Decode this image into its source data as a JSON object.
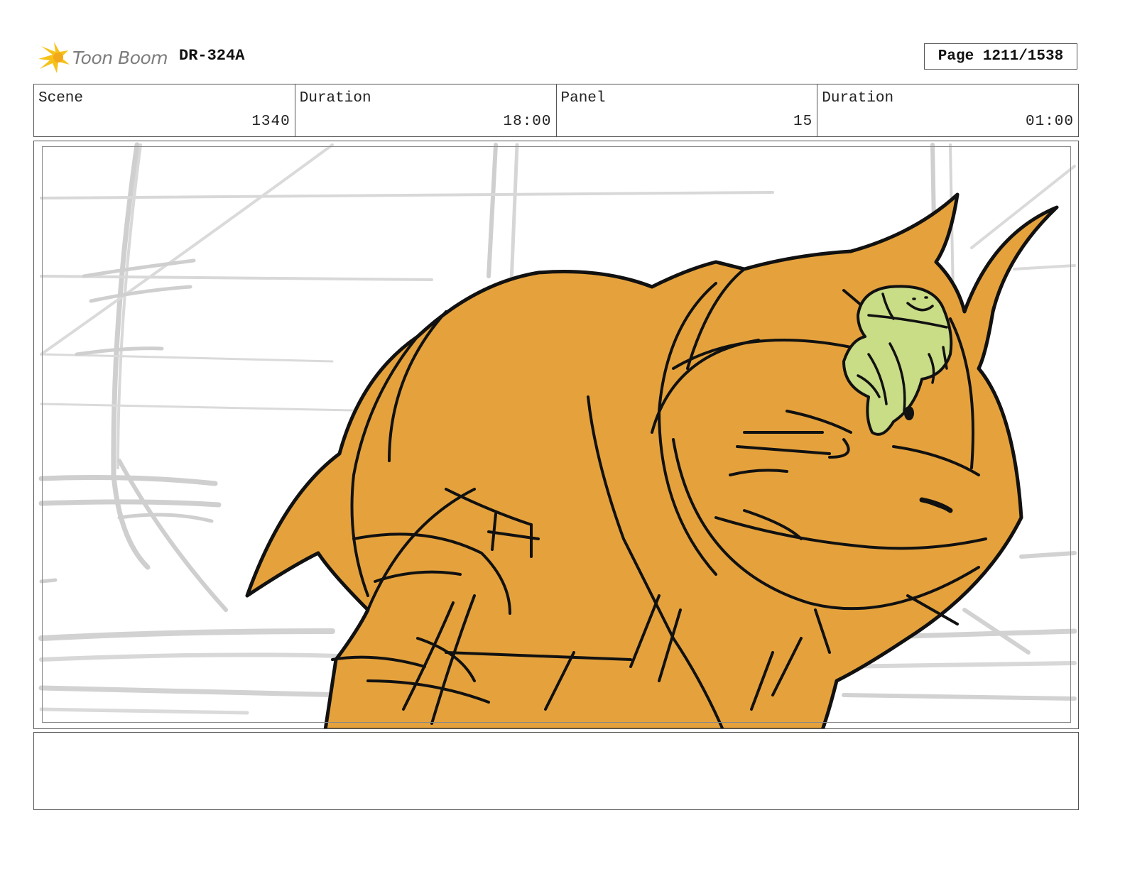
{
  "header": {
    "logo_text": "Toon Boom",
    "production_code": "DR-324A",
    "page_label": "Page 1211/1538"
  },
  "info": {
    "scene_label": "Scene",
    "scene_value": "1340",
    "scene_duration_label": "Duration",
    "scene_duration_value": "18:00",
    "panel_label": "Panel",
    "panel_value": "15",
    "panel_duration_label": "Duration",
    "panel_duration_value": "01:00"
  },
  "panel": {
    "creature_color": "#e5a23c",
    "small_creature_color": "#c9dc86",
    "line_color": "#111111",
    "background_sketch_color": "#cfcfcf"
  },
  "notes": {
    "text": ""
  }
}
